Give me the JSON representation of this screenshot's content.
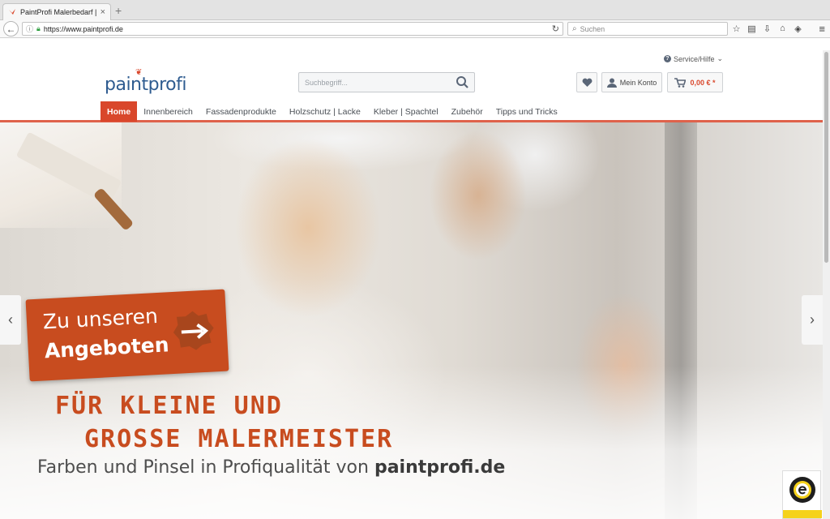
{
  "browser": {
    "tab_title": "PaintProfi Malerbedarf | PaintP",
    "tab_close": "×",
    "new_tab": "+",
    "url": "https://www.paintprofi.de",
    "search_placeholder": "Suchen"
  },
  "header": {
    "service_label": "Service/Hilfe",
    "logo_paint": "paint",
    "logo_profi": "profi",
    "search_placeholder": "Suchbegriff...",
    "account_label": "Mein Konto",
    "cart_price": "0,00 € *"
  },
  "nav": {
    "items": [
      "Home",
      "Innenbereich",
      "Fassadenprodukte",
      "Holzschutz | Lacke",
      "Kleber | Spachtel",
      "Zubehör",
      "Tipps und Tricks"
    ],
    "active": "Home"
  },
  "hero": {
    "cta_line1": "Zu unseren",
    "cta_line2": "Angeboten",
    "headline_line1": "FÜR KLEINE UND",
    "headline_line2": "GROSSE MALERMEISTER",
    "subline_text": "Farben und Pinsel in Profiqualität von ",
    "subline_brand": "paintprofi.de",
    "prev_arrow": "‹",
    "next_arrow": "›"
  },
  "colors": {
    "accent": "#d9472b",
    "brand_blue": "#2f5c90",
    "cta": "#c84c1f"
  },
  "icons": [
    "firefox-favicon",
    "back-icon",
    "info-icon",
    "lock-icon",
    "reload-icon",
    "search-icon",
    "star-icon",
    "clipboard-icon",
    "download-icon",
    "home-icon",
    "pocket-icon",
    "menu-icon",
    "heart-icon",
    "user-icon",
    "cart-icon",
    "arrow-icon",
    "trusted-shops-seal"
  ]
}
